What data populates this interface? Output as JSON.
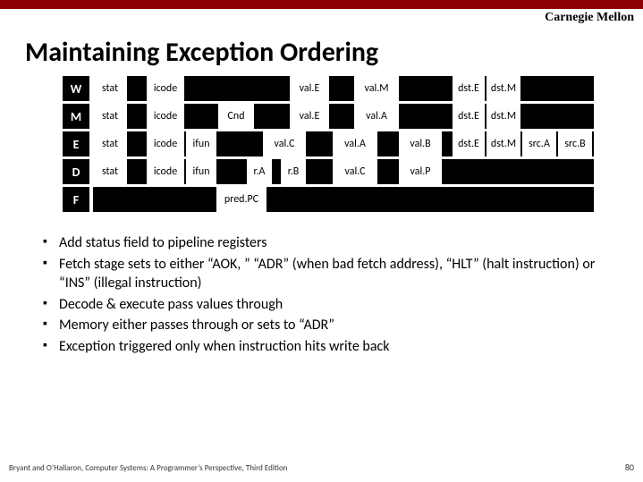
{
  "university": "Carnegie Mellon",
  "title": "Maintaining Exception Ordering",
  "rows": {
    "W": {
      "stage": "W",
      "cells": [
        {
          "l": 0,
          "w": 38,
          "t": "stat"
        },
        {
          "l": 60,
          "w": 42,
          "t": "icode"
        },
        {
          "l": 220,
          "w": 44,
          "t": "val.E"
        },
        {
          "l": 292,
          "w": 50,
          "t": "val.M"
        },
        {
          "l": 402,
          "w": 36,
          "t": "dst.E"
        },
        {
          "l": 440,
          "w": 38,
          "t": "dst.M"
        }
      ]
    },
    "M": {
      "stage": "M",
      "cells": [
        {
          "l": 0,
          "w": 38,
          "t": "stat"
        },
        {
          "l": 60,
          "w": 42,
          "t": "icode"
        },
        {
          "l": 140,
          "w": 40,
          "t": "Cnd"
        },
        {
          "l": 220,
          "w": 44,
          "t": "val.E"
        },
        {
          "l": 292,
          "w": 50,
          "t": "val.A"
        },
        {
          "l": 402,
          "w": 36,
          "t": "dst.E"
        },
        {
          "l": 440,
          "w": 38,
          "t": "dst.M"
        }
      ]
    },
    "E": {
      "stage": "E",
      "cells": [
        {
          "l": 0,
          "w": 38,
          "t": "stat"
        },
        {
          "l": 60,
          "w": 42,
          "t": "icode"
        },
        {
          "l": 104,
          "w": 34,
          "t": "ifun"
        },
        {
          "l": 190,
          "w": 48,
          "t": "val.C"
        },
        {
          "l": 268,
          "w": 50,
          "t": "val.A"
        },
        {
          "l": 342,
          "w": 48,
          "t": "val.B"
        },
        {
          "l": 402,
          "w": 36,
          "t": "dst.E"
        },
        {
          "l": 440,
          "w": 38,
          "t": "dst.M"
        },
        {
          "l": 480,
          "w": 38,
          "t": "src.A"
        },
        {
          "l": 520,
          "w": 38,
          "t": "src.B"
        }
      ]
    },
    "D": {
      "stage": "D",
      "cells": [
        {
          "l": 0,
          "w": 38,
          "t": "stat"
        },
        {
          "l": 60,
          "w": 42,
          "t": "icode"
        },
        {
          "l": 104,
          "w": 34,
          "t": "ifun"
        },
        {
          "l": 172,
          "w": 28,
          "t": "r.A"
        },
        {
          "l": 210,
          "w": 28,
          "t": "r.B"
        },
        {
          "l": 268,
          "w": 50,
          "t": "val.C"
        },
        {
          "l": 342,
          "w": 48,
          "t": "val.P"
        }
      ]
    },
    "F": {
      "stage": "F",
      "cells": [
        {
          "l": 138,
          "w": 56,
          "t": "pred.PC"
        }
      ]
    }
  },
  "bullets": [
    "Add status field to pipeline registers",
    "Fetch stage sets to either “AOK, ” “ADR” (when bad fetch address), “HLT” (halt instruction) or “INS” (illegal instruction)",
    "Decode & execute pass values through",
    "Memory either passes through or sets to “ADR”",
    "Exception triggered only when instruction hits write back"
  ],
  "footer": "Bryant and O’Hallaron, Computer Systems: A Programmer’s Perspective, Third Edition",
  "page": "80"
}
